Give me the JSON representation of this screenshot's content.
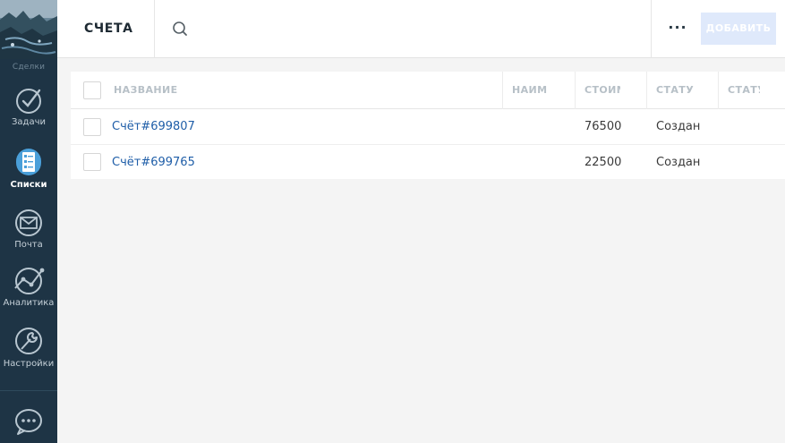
{
  "sidebar": {
    "logo_caption": "Сделки",
    "items": [
      {
        "label": "Задачи",
        "icon": "checkmark-circle-icon",
        "active": false
      },
      {
        "label": "Списки",
        "icon": "list-icon",
        "active": true
      },
      {
        "label": "Почта",
        "icon": "mail-icon",
        "active": false
      },
      {
        "label": "Аналитика",
        "icon": "analytics-icon",
        "active": false
      },
      {
        "label": "Настройки",
        "icon": "wrench-icon",
        "active": false
      }
    ],
    "chat_icon": "chat-bubble-icon"
  },
  "header": {
    "title": "СЧЕТА",
    "search_value": "",
    "more_label": "···",
    "add_label": "ДОБАВИТЬ"
  },
  "table": {
    "columns": [
      "НАЗВАНИЕ",
      "НАИМ",
      "СТОИМ",
      "СТАТУ",
      "СТАТУ"
    ],
    "rows": [
      {
        "name": "Счёт#699807",
        "naim": "",
        "cost": "76500",
        "status": "Создан",
        "status2": ""
      },
      {
        "name": "Счёт#699765",
        "naim": "",
        "cost": "22500",
        "status": "Создан",
        "status2": ""
      }
    ]
  },
  "colors": {
    "sidebar_bg": "#1e3445",
    "accent": "#4a9fd9",
    "link": "#1f5ea8",
    "add_button_bg": "#dfe9fb"
  }
}
